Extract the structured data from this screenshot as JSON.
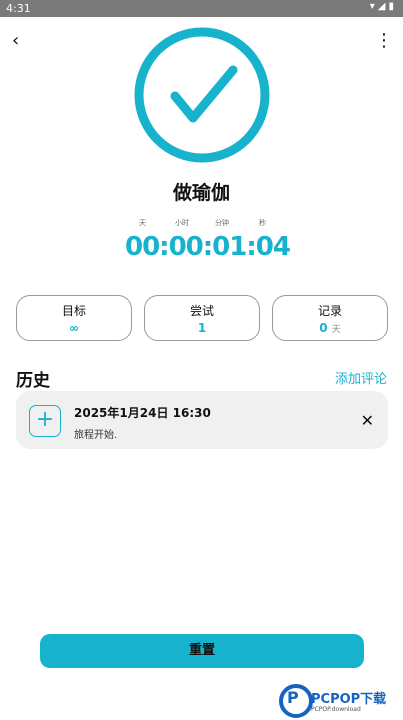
{
  "status_bar": {
    "time": "4:31",
    "icons": [
      "wifi-icon",
      "signal-icon",
      "battery-icon"
    ]
  },
  "header": {
    "back_icon": "‹",
    "more_icon": "⋮"
  },
  "task": {
    "title": "做瑜伽"
  },
  "timer": {
    "labels": [
      "天",
      "小时",
      "分钟",
      "秒"
    ],
    "value": "00:00:01:04"
  },
  "cards": [
    {
      "label": "目标",
      "value": "∞",
      "unit": ""
    },
    {
      "label": "尝试",
      "value": "1",
      "unit": ""
    },
    {
      "label": "记录",
      "value": "0",
      "unit": "天"
    }
  ],
  "history": {
    "title": "历史",
    "add_comment": "添加评论",
    "entries": [
      {
        "date": "2025年1月24日  16:30",
        "desc": "旅程开始."
      }
    ]
  },
  "reset_label": "重置",
  "watermark": {
    "text": "PCPOP下载",
    "sub": "PCPOP.download"
  },
  "colors": {
    "accent": "#17b3cc"
  }
}
